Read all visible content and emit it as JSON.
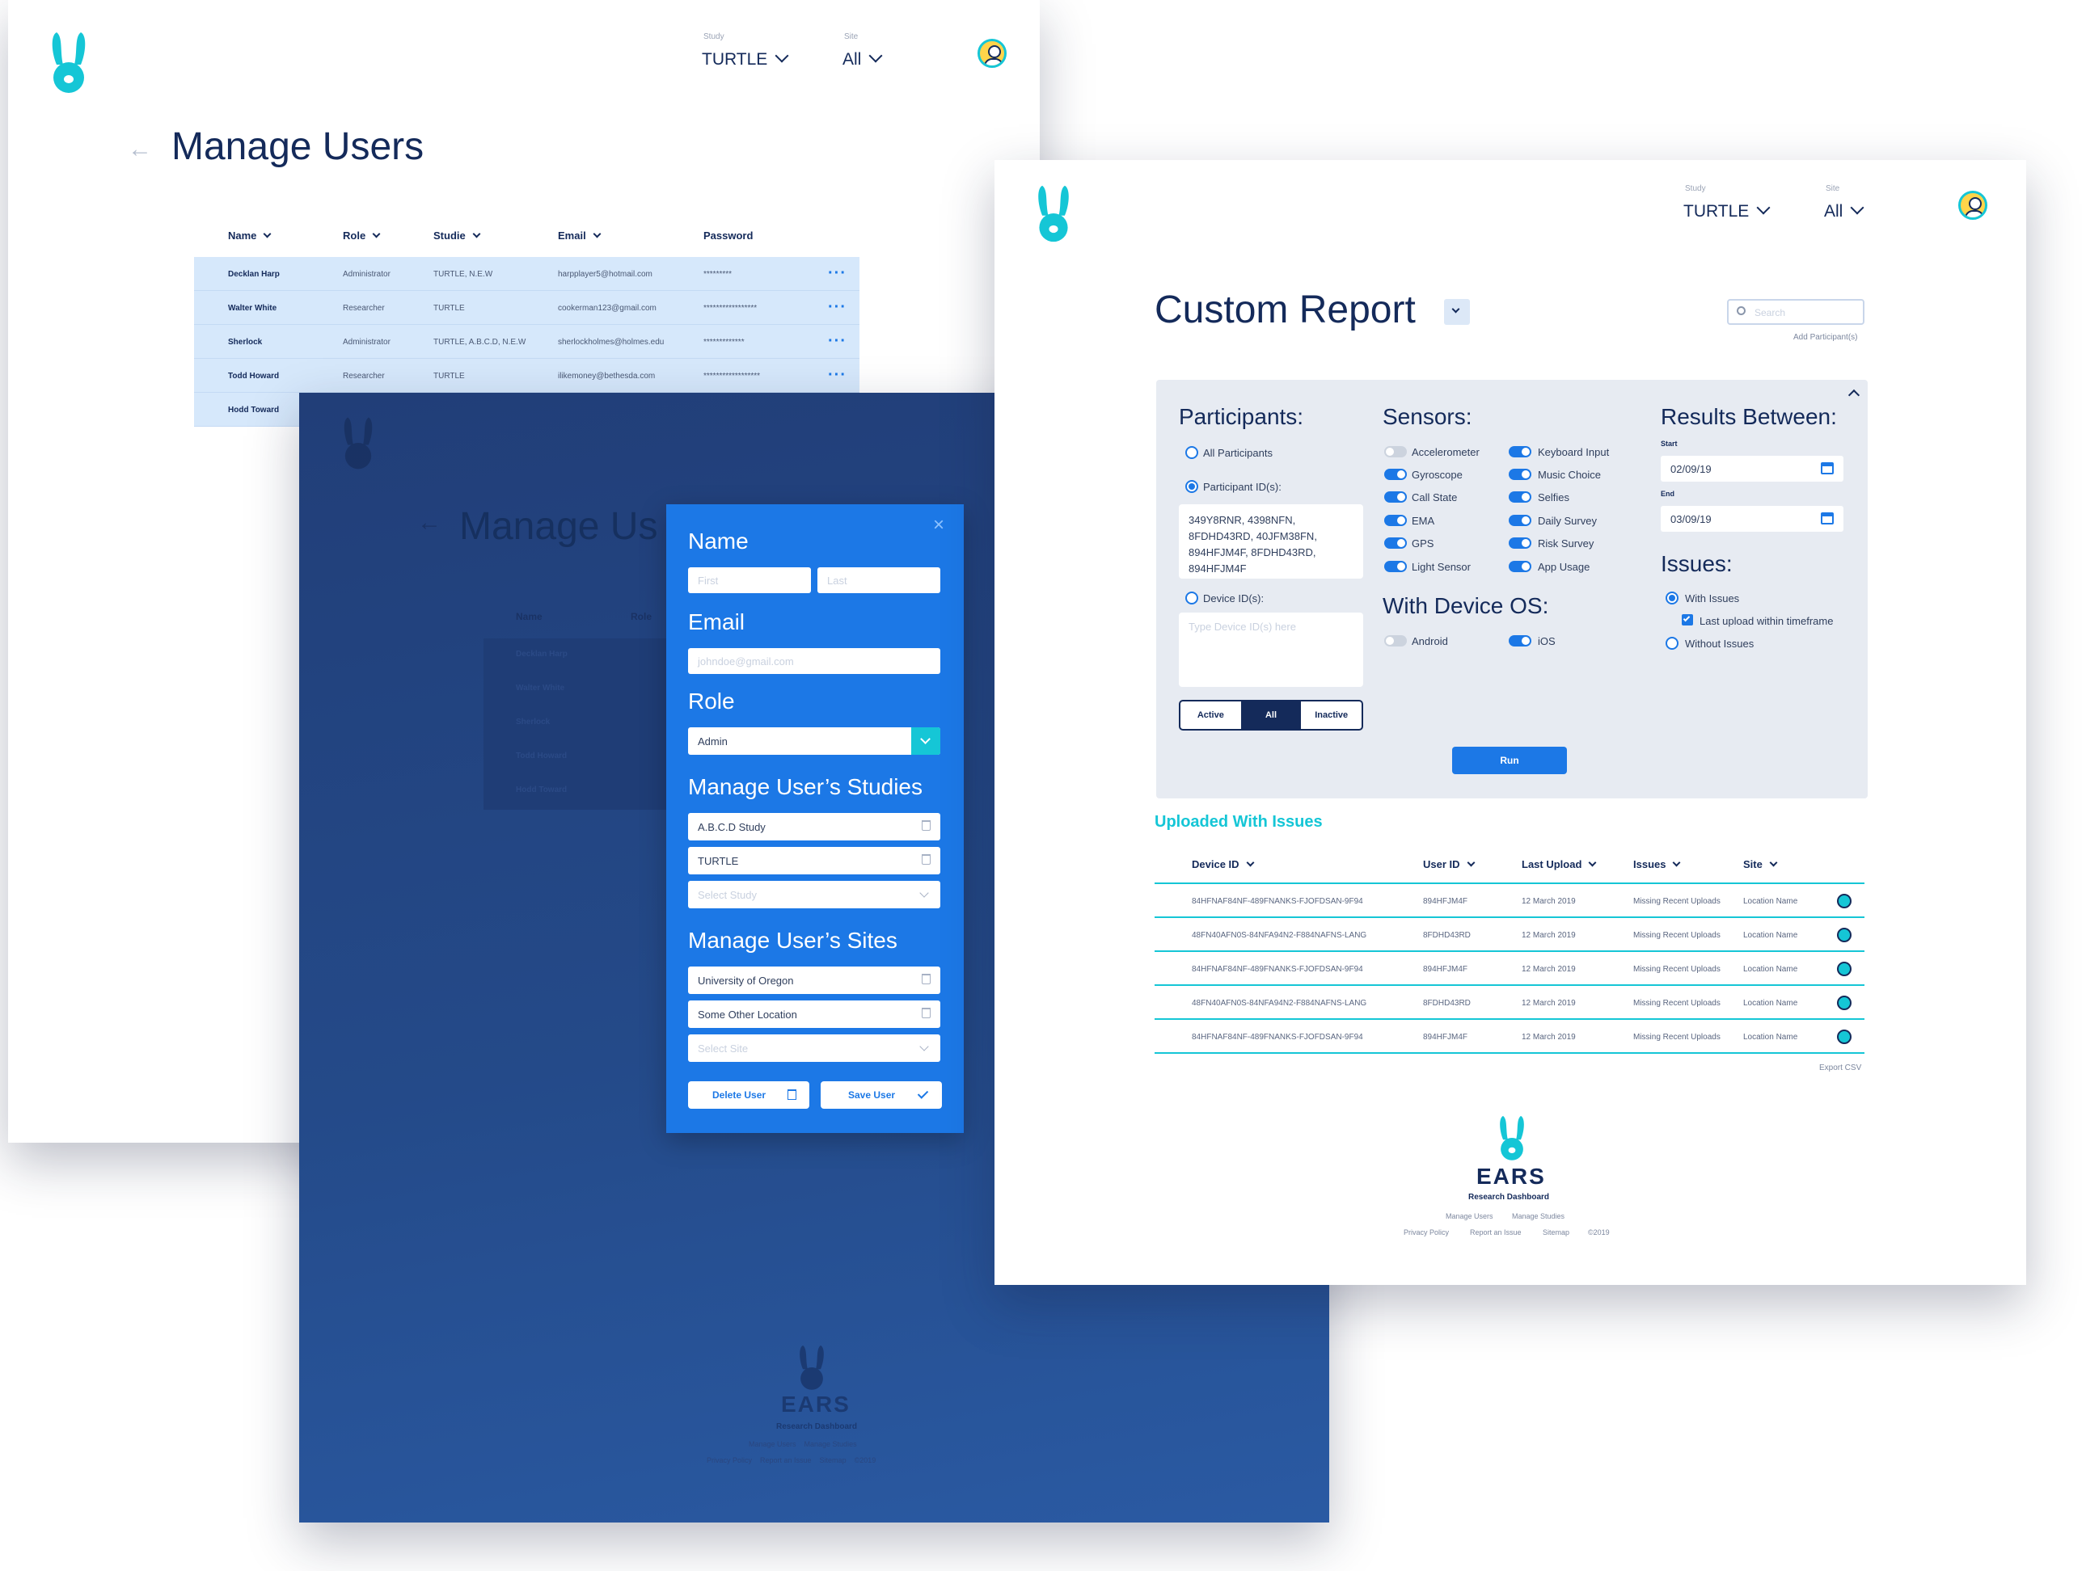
{
  "colors": {
    "accent": "#15c6d6",
    "primary": "#1c78e6",
    "navy": "#142a5a",
    "overlay": "#244b8c"
  },
  "manage_users": {
    "study_label": "Study",
    "study_value": "TURTLE",
    "site_label": "Site",
    "site_value": "All",
    "title": "Manage Users",
    "columns": [
      "Name",
      "Role",
      "Studie",
      "Email",
      "Password"
    ],
    "rows": [
      {
        "name": "Decklan Harp",
        "role": "Administrator",
        "studies": "TURTLE, N.E.W",
        "email": "harpplayer5@hotmail.com",
        "password": "*********"
      },
      {
        "name": "Walter White",
        "role": "Researcher",
        "studies": "TURTLE",
        "email": "cookerman123@gmail.com",
        "password": "*****************"
      },
      {
        "name": "Sherlock",
        "role": "Administrator",
        "studies": "TURTLE, A.B.C.D, N.E.W",
        "email": "sherlockholmes@holmes.edu",
        "password": "*************"
      },
      {
        "name": "Todd Howard",
        "role": "Researcher",
        "studies": "TURTLE",
        "email": "ilikemoney@bethesda.com",
        "password": "******************"
      },
      {
        "name": "Hodd Toward",
        "role": "",
        "studies": "",
        "email": "",
        "password": ""
      }
    ]
  },
  "overlay_bg": {
    "title": "Manage Us",
    "col_name": "Name",
    "col_role": "Role",
    "rows": [
      "Decklan Harp",
      "Walter White",
      "Sherlock",
      "Todd Howard",
      "Hodd Toward"
    ],
    "footer_brand": "EARS",
    "footer_sub": "Research Dashboard",
    "footer_links_1": "Manage Users    Manage Studies",
    "footer_links_2": "Privacy Policy    Report an Issue    Sitemap    ©2019"
  },
  "modal": {
    "close": "×",
    "name_heading": "Name",
    "first_placeholder": "First",
    "last_placeholder": "Last",
    "email_heading": "Email",
    "email_placeholder": "johndoe@gmail.com",
    "role_heading": "Role",
    "role_value": "Admin",
    "studies_heading": "Manage User’s Studies",
    "studies": [
      "A.B.C.D Study",
      "TURTLE"
    ],
    "study_placeholder": "Select Study",
    "sites_heading": "Manage User’s Sites",
    "sites": [
      "University of Oregon",
      "Some Other Location"
    ],
    "site_placeholder": "Select Site",
    "delete_label": "Delete User",
    "save_label": "Save User"
  },
  "custom_report": {
    "study_label": "Study",
    "study_value": "TURTLE",
    "site_label": "Site",
    "site_value": "All",
    "title": "Custom Report",
    "search_placeholder": "Search",
    "add_participants": "Add Participant(s)",
    "participants_heading": "Participants:",
    "opt_all": "All Participants",
    "opt_pid": "Participant ID(s):",
    "pid_value": "349Y8RNR, 4398NFN, 8FDHD43RD, 40JFM38FN, 894HFJM4F, 8FDHD43RD, 894HFJM4F",
    "opt_did": "Device ID(s):",
    "did_placeholder": "Type Device ID(s) here",
    "seg": [
      "Active",
      "All",
      "Inactive"
    ],
    "sensors_heading": "Sensors:",
    "sensors_left": [
      {
        "label": "Accelerometer",
        "on": false
      },
      {
        "label": "Gyroscope",
        "on": true
      },
      {
        "label": "Call State",
        "on": true
      },
      {
        "label": "EMA",
        "on": true
      },
      {
        "label": "GPS",
        "on": true
      },
      {
        "label": "Light Sensor",
        "on": true
      }
    ],
    "sensors_right": [
      {
        "label": "Keyboard Input",
        "on": true
      },
      {
        "label": "Music Choice",
        "on": true
      },
      {
        "label": "Selfies",
        "on": true
      },
      {
        "label": "Daily Survey",
        "on": true
      },
      {
        "label": "Risk Survey",
        "on": true
      },
      {
        "label": "App Usage",
        "on": true
      }
    ],
    "os_heading": "With Device OS:",
    "os_android": "Android",
    "os_ios": "iOS",
    "results_heading": "Results Between:",
    "start_label": "Start",
    "start_value": "02/09/19",
    "end_label": "End",
    "end_value": "03/09/19",
    "issues_heading": "Issues:",
    "with_issues": "With Issues",
    "last_upload": "Last upload within timeframe",
    "without_issues": "Without Issues",
    "run_label": "Run",
    "uploaded_heading": "Uploaded With Issues",
    "columns": [
      "Device ID",
      "User ID",
      "Last Upload",
      "Issues",
      "Site"
    ],
    "rows": [
      {
        "device": "84HFNAF84NF-489FNANKS-FJOFDSAN-9F94",
        "user": "894HFJM4F",
        "upload": "12 March 2019",
        "issue": "Missing Recent Uploads",
        "site": "Location Name"
      },
      {
        "device": "48FN40AFN0S-84NFA94N2-F884NAFNS-LANG",
        "user": "8FDHD43RD",
        "upload": "12 March 2019",
        "issue": "Missing Recent Uploads",
        "site": "Location Name"
      },
      {
        "device": "84HFNAF84NF-489FNANKS-FJOFDSAN-9F94",
        "user": "894HFJM4F",
        "upload": "12 March 2019",
        "issue": "Missing Recent Uploads",
        "site": "Location Name"
      },
      {
        "device": "48FN40AFN0S-84NFA94N2-F884NAFNS-LANG",
        "user": "8FDHD43RD",
        "upload": "12 March 2019",
        "issue": "Missing Recent Uploads",
        "site": "Location Name"
      },
      {
        "device": "84HFNAF84NF-489FNANKS-FJOFDSAN-9F94",
        "user": "894HFJM4F",
        "upload": "12 March 2019",
        "issue": "Missing Recent Uploads",
        "site": "Location Name"
      }
    ],
    "export": "Export CSV",
    "footer_brand": "EARS",
    "footer_sub": "Research Dashboard",
    "footer_manage_users": "Manage Users",
    "footer_manage_studies": "Manage Studies",
    "footer_privacy": "Privacy Policy",
    "footer_report": "Report an Issue",
    "footer_sitemap": "Sitemap",
    "footer_copy": "©2019"
  }
}
